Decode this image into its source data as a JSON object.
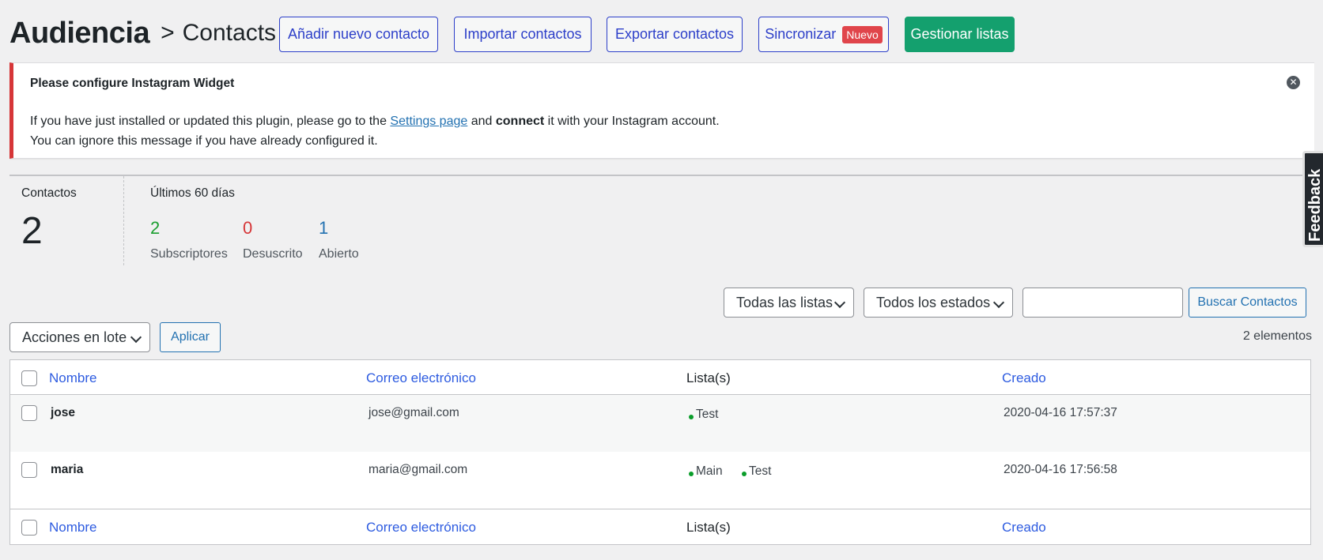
{
  "header": {
    "title": "Audiencia",
    "separator": ">",
    "subtitle": "Contacts",
    "buttons": {
      "add": "Añadir nuevo contacto",
      "import": "Importar contactos",
      "export": "Exportar contactos",
      "sync": "Sincronizar",
      "sync_badge": "Nuevo",
      "manage": "Gestionar listas"
    }
  },
  "notice": {
    "title": "Please configure Instagram Widget",
    "line1_prefix": "If you have just installed or updated this plugin, please go to the ",
    "line1_link": "Settings page",
    "line1_mid": " and ",
    "line1_bold": "connect",
    "line1_suffix": " it with your Instagram account.",
    "line2": "You can ignore this message if you have already configured it.",
    "close_icon": "close-circle-icon"
  },
  "stats": {
    "contacts_label": "Contactos",
    "contacts_value": "2",
    "period_label": "Últimos 60 días",
    "subscribed_value": "2",
    "subscribed_label": "Subscriptores",
    "unsubscribed_value": "0",
    "unsubscribed_label": "Desuscrito",
    "open_value": "1",
    "open_label": "Abierto",
    "colors": {
      "subscribed": "#1a9e2f",
      "unsubscribed": "#d63638",
      "open": "#2271b1"
    }
  },
  "feedback": {
    "label": "Feedback"
  },
  "filters": {
    "lists_select": "Todas las listas",
    "status_select": "Todos los estados",
    "search_placeholder": "",
    "search_button": "Buscar Contactos",
    "bulk_select": "Acciones en lote",
    "apply_button": "Aplicar",
    "count": "2 elementos"
  },
  "table": {
    "columns": {
      "name": "Nombre",
      "email": "Correo electrónico",
      "lists": "Lista(s)",
      "created": "Creado"
    },
    "rows": [
      {
        "name": "jose",
        "email": "jose@gmail.com",
        "lists": [
          "Test"
        ],
        "created": "2020-04-16 17:57:37"
      },
      {
        "name": "maria",
        "email": "maria@gmail.com",
        "lists": [
          "Main",
          "Test"
        ],
        "created": "2020-04-16 17:56:58"
      }
    ]
  }
}
